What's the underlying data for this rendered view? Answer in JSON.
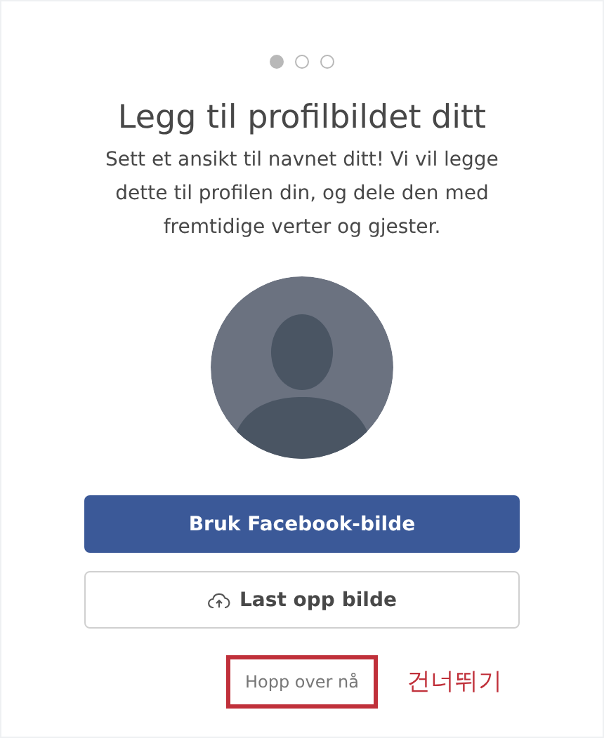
{
  "steps": [
    {
      "selected": true
    },
    {
      "selected": false
    },
    {
      "selected": false
    }
  ],
  "title": "Legg til profilbildet ditt",
  "description": "Sett et ansikt til navnet ditt! Vi vil legge dette til profilen din, og dele den med fremtidige verter og gjester.",
  "buttons": [
    {
      "kind": "primary",
      "label": "Bruk Facebook-bilde"
    },
    {
      "kind": "upload",
      "label": "Last opp bilde"
    }
  ],
  "skip_link": {
    "label": "Hopp over nå",
    "highlighted": true
  },
  "annotation": {
    "text": "건너뛰기"
  }
}
